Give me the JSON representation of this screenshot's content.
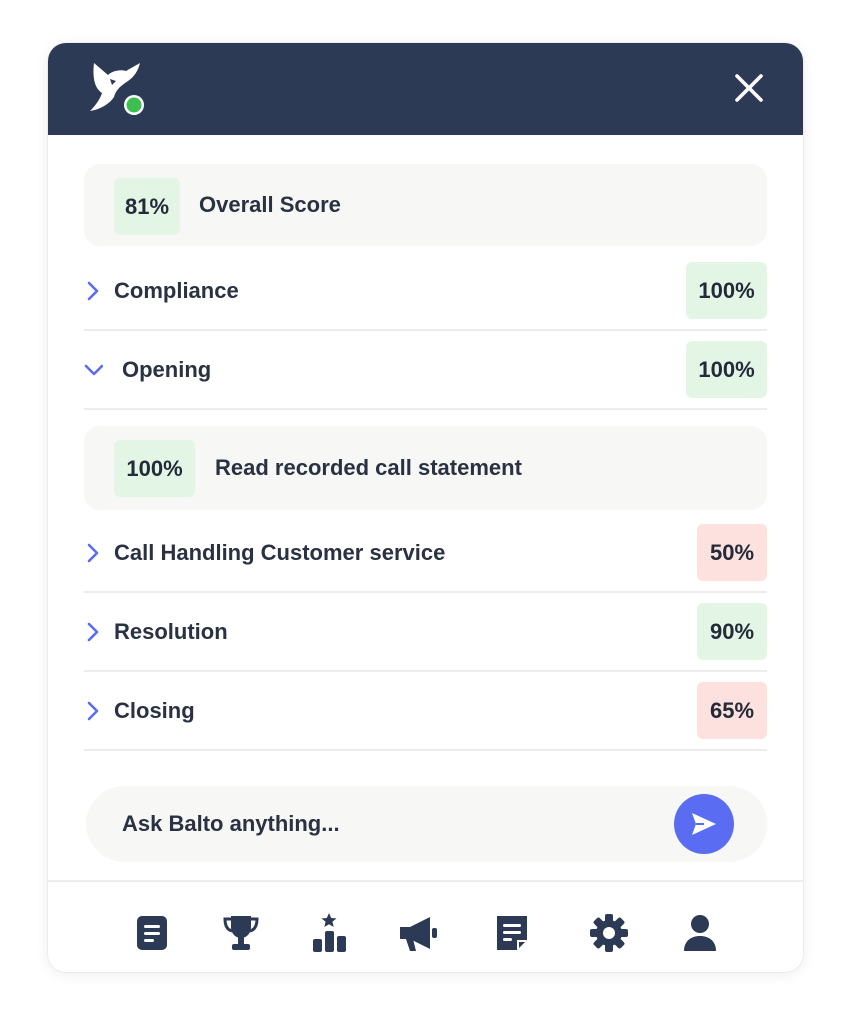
{
  "header": {
    "logo_icon": "balto-wolf-logo",
    "status_color": "#3cbf4f",
    "close_icon": "close-icon"
  },
  "overall": {
    "score": "81%",
    "label": "Overall Score"
  },
  "categories": [
    {
      "label": "Compliance",
      "score": "100%",
      "status": "good",
      "expanded": false
    },
    {
      "label": "Opening",
      "score": "100%",
      "status": "good",
      "expanded": true
    },
    {
      "label": "Call Handling Customer service",
      "score": "50%",
      "status": "bad",
      "expanded": false
    },
    {
      "label": "Resolution",
      "score": "90%",
      "status": "good",
      "expanded": false
    },
    {
      "label": "Closing",
      "score": "65%",
      "status": "bad",
      "expanded": false
    }
  ],
  "opening_detail": {
    "score": "100%",
    "label": "Read recorded call statement"
  },
  "ask": {
    "placeholder": "Ask Balto anything...",
    "send_icon": "send-icon"
  },
  "nav": [
    {
      "icon": "document-icon"
    },
    {
      "icon": "trophy-icon"
    },
    {
      "icon": "leaderboard-icon"
    },
    {
      "icon": "megaphone-icon"
    },
    {
      "icon": "notes-icon"
    },
    {
      "icon": "gear-icon"
    },
    {
      "icon": "user-icon"
    }
  ],
  "colors": {
    "header_bg": "#2d3a55",
    "accent": "#5a6cf2",
    "good_bg": "#e3f6e6",
    "bad_bg": "#fde1df",
    "icon": "#2d3a55"
  }
}
